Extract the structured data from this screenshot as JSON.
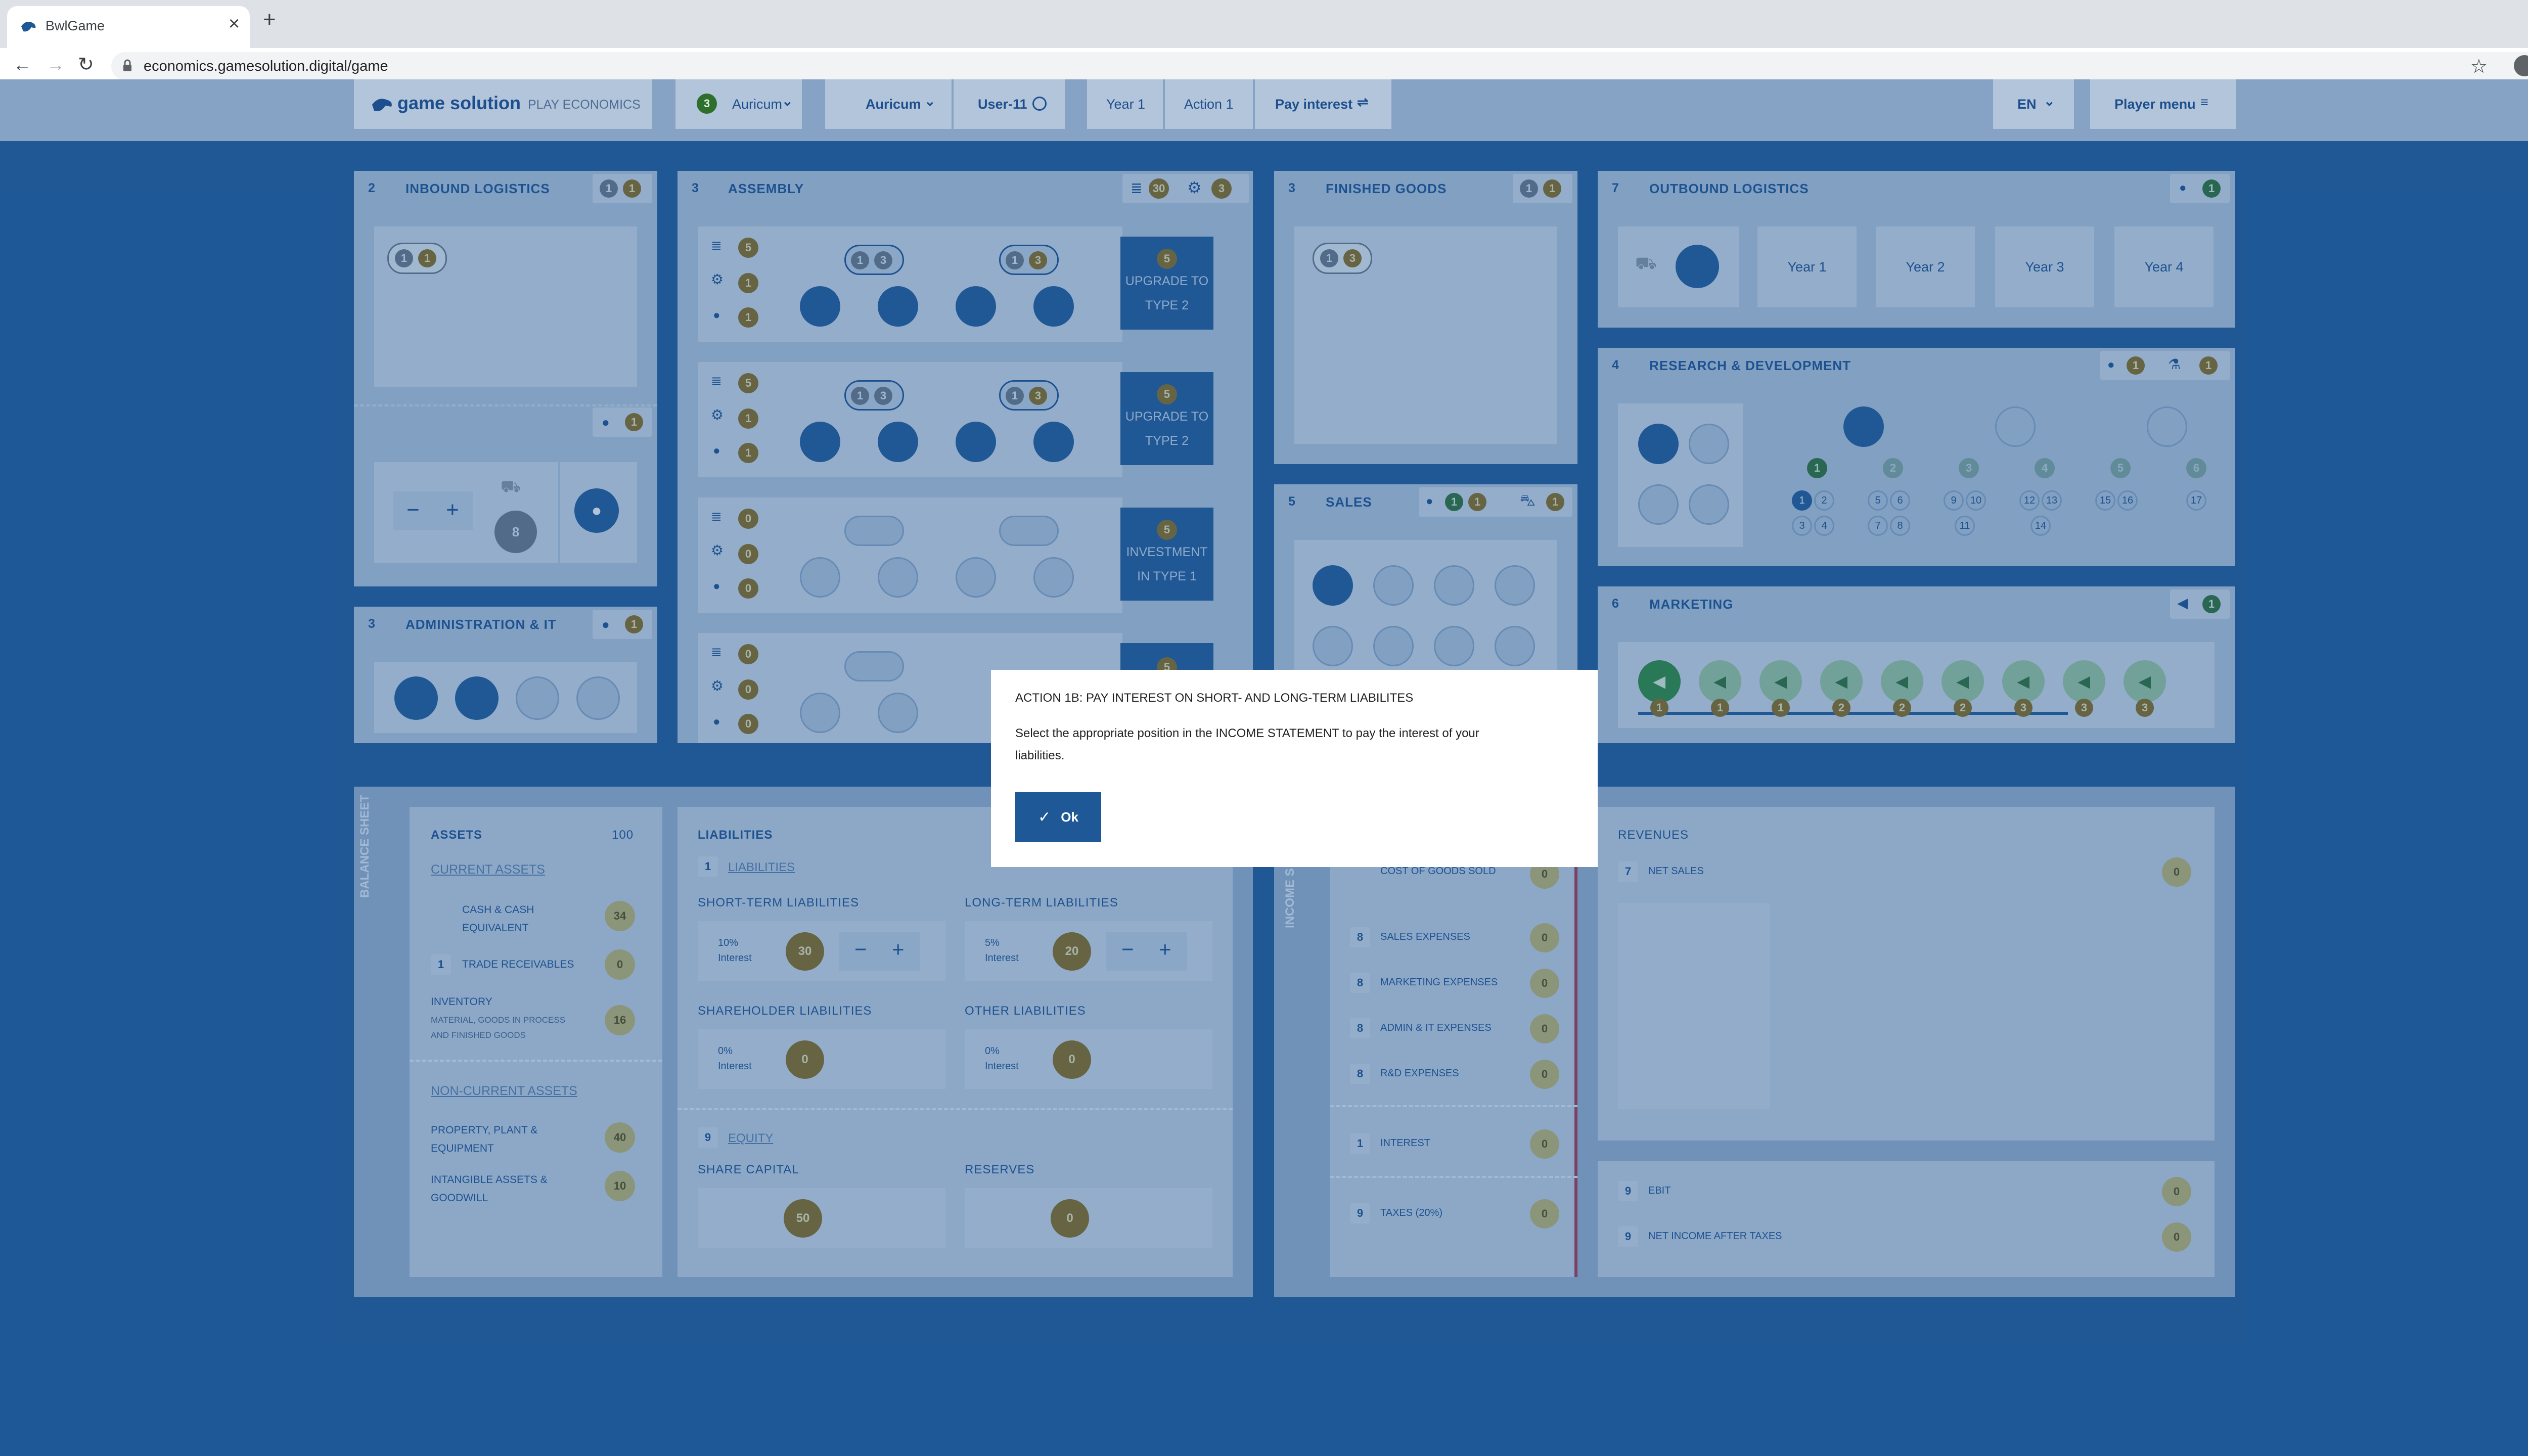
{
  "browser": {
    "tab_title": "BwlGame",
    "url": "economics.gamesolution.digital/game",
    "new_tab": "+",
    "close": "×"
  },
  "header": {
    "logo": "game solution",
    "subtitle": "PLAY ECONOMICS",
    "company_badge": "3",
    "company": "Auricum",
    "market": "Auricum",
    "user": "User-11",
    "year": "Year 1",
    "action": "Action 1",
    "current_step": "Pay interest",
    "language": "EN",
    "player_menu": "Player menu"
  },
  "inbound": {
    "num": "2",
    "title": "INBOUND LOGISTICS",
    "b1": "1",
    "b2": "1",
    "slot1": "1",
    "slot2": "1",
    "staff": "1",
    "stock": "8",
    "minus": "−",
    "plus": "+"
  },
  "admin": {
    "num": "3",
    "title": "ADMINISTRATION & IT",
    "staff": "1"
  },
  "assembly": {
    "num": "3",
    "title": "ASSEMBLY",
    "stock": "30",
    "machines": "3",
    "lines": [
      {
        "c1": "5",
        "c2": "1",
        "c3": "1",
        "p1a": "1",
        "p1b": "3",
        "p2a": "1",
        "p2b": "3",
        "btn_num": "5",
        "btn_a": "UPGRADE TO",
        "btn_b": "TYPE 2"
      },
      {
        "c1": "5",
        "c2": "1",
        "c3": "1",
        "p1a": "1",
        "p1b": "3",
        "p2a": "1",
        "p2b": "3",
        "btn_num": "5",
        "btn_a": "UPGRADE TO",
        "btn_b": "TYPE 2"
      },
      {
        "c1": "0",
        "c2": "0",
        "c3": "0",
        "btn_num": "5",
        "btn_a": "INVESTMENT",
        "btn_b": "IN TYPE 1"
      },
      {
        "c1": "0",
        "c2": "0",
        "c3": "0",
        "btn_num": "5"
      }
    ]
  },
  "finished": {
    "num": "3",
    "title": "FINISHED GOODS",
    "b1": "1",
    "b2": "1",
    "s1": "1",
    "s2": "3"
  },
  "sales": {
    "num": "5",
    "title": "SALES",
    "g": "1",
    "d": "1",
    "car": "1"
  },
  "outbound": {
    "num": "7",
    "title": "OUTBOUND LOGISTICS",
    "staff": "1",
    "years": [
      "Year 1",
      "Year 2",
      "Year 3",
      "Year 4"
    ]
  },
  "rnd": {
    "num": "4",
    "title": "RESEARCH & DEVELOPMENT",
    "staff": "1",
    "lab": "1",
    "top": [
      "1",
      "2",
      "3",
      "4",
      "5",
      "6"
    ],
    "nums": [
      "1",
      "2",
      "3",
      "4",
      "5",
      "6",
      "7",
      "8",
      "9",
      "10",
      "11",
      "12",
      "13",
      "14",
      "15",
      "16",
      "17"
    ]
  },
  "marketing": {
    "num": "6",
    "title": "MARKETING",
    "count": "1",
    "levels": [
      "1",
      "1",
      "1",
      "2",
      "2",
      "2",
      "3",
      "3",
      "3"
    ]
  },
  "balance": {
    "side_label": "BALANCE SHEET",
    "assets": {
      "title": "ASSETS",
      "total": "100",
      "current": "CURRENT ASSETS",
      "cash_a": "CASH & CASH",
      "cash_b": "EQUIVALENT",
      "cash_val": "34",
      "trade_num": "1",
      "trade": "TRADE RECEIVABLES",
      "trade_val": "0",
      "inv": "INVENTORY",
      "inv_sub_a": "MATERIAL, GOODS IN PROCESS",
      "inv_sub_b": "AND FINISHED GOODS",
      "inv_val": "16",
      "noncurrent": "NON-CURRENT ASSETS",
      "ppe_a": "PROPERTY, PLANT &",
      "ppe_b": "EQUIPMENT",
      "ppe_val": "40",
      "intang_a": "INTANGIBLE ASSETS &",
      "intang_b": "GOODWILL",
      "intang_val": "10"
    },
    "liabilities": {
      "title": "LIABILITIES",
      "link_num": "1",
      "link": "LIABILITIES",
      "short": "SHORT-TERM LIABILITIES",
      "short_rate": "10%",
      "short_val": "30",
      "long": "LONG-TERM LIABILITIES",
      "long_rate": "5%",
      "long_val": "20",
      "share": "SHAREHOLDER LIABILITIES",
      "share_rate": "0%",
      "share_val": "0",
      "other": "OTHER LIABILITIES",
      "other_rate": "0%",
      "other_val": "0",
      "interest": "Interest",
      "equity_num": "9",
      "equity": "EQUITY",
      "capital": "SHARE CAPITAL",
      "capital_val": "50",
      "reserves": "RESERVES",
      "reserves_val": "0"
    }
  },
  "income": {
    "side_label": "INCOME S",
    "cogs": "COST OF GOODS SOLD",
    "cogs_val": "0",
    "rows": [
      {
        "n": "8",
        "label": "SALES EXPENSES",
        "val": "0"
      },
      {
        "n": "8",
        "label": "MARKETING EXPENSES",
        "val": "0"
      },
      {
        "n": "8",
        "label": "ADMIN & IT EXPENSES",
        "val": "0"
      },
      {
        "n": "8",
        "label": "R&D EXPENSES",
        "val": "0"
      }
    ],
    "interest_num": "1",
    "interest": "INTEREST",
    "interest_val": "0",
    "taxes_num": "9",
    "taxes": "TAXES (20%)",
    "taxes_val": "0",
    "revenues": "REVENUES",
    "net_sales_num": "7",
    "net_sales": "NET SALES",
    "net_sales_val": "0",
    "ebit_num": "9",
    "ebit": "EBIT",
    "ebit_val": "0",
    "nia_num": "9",
    "nia": "NET INCOME AFTER TAXES",
    "nia_val": "0"
  },
  "modal": {
    "title": "ACTION 1B: PAY INTEREST ON SHORT- AND LONG-TERM LIABILITES",
    "body_a": "Select the appropriate position in the INCOME STATEMENT to pay the interest of your",
    "body_b": "liabilities.",
    "ok": "Ok"
  }
}
